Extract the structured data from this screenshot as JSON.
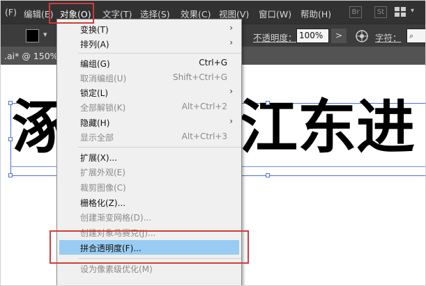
{
  "menubar": {
    "items": [
      {
        "label": "(F)"
      },
      {
        "label": "编辑(E)"
      },
      {
        "label": "对象(O)"
      },
      {
        "label": "文字(T)"
      },
      {
        "label": "选择(S)"
      },
      {
        "label": "效果(C)"
      },
      {
        "label": "视图(V)"
      },
      {
        "label": "窗口(W)"
      },
      {
        "label": "帮助(H)"
      }
    ],
    "bridge_icon": "Br",
    "stock_icon": "St",
    "workspace_icon": "grid-icon"
  },
  "controlbar": {
    "opacity_label": "不透明度：",
    "opacity_value": "100%",
    "opacity_arrow": ">",
    "char_label": "字符："
  },
  "doc": {
    "tab_label": ".ai* @ 150%"
  },
  "canvas": {
    "text_left": "涿",
    "text_right": "江东进"
  },
  "dropdown": {
    "items": [
      {
        "label": "变换(T)",
        "shortcut": "",
        "arrow": "›"
      },
      {
        "label": "排列(A)",
        "shortcut": "",
        "arrow": "›"
      },
      {
        "label": "编组(G)",
        "shortcut": "Ctrl+G",
        "arrow": ""
      },
      {
        "label": "取消编组(U)",
        "shortcut": "Shift+Ctrl+G",
        "arrow": ""
      },
      {
        "label": "锁定(L)",
        "shortcut": "",
        "arrow": "›"
      },
      {
        "label": "全部解锁(K)",
        "shortcut": "Alt+Ctrl+2",
        "arrow": ""
      },
      {
        "label": "隐藏(H)",
        "shortcut": "",
        "arrow": "›"
      },
      {
        "label": "显示全部",
        "shortcut": "Alt+Ctrl+3",
        "arrow": ""
      },
      {
        "label": "扩展(X)...",
        "shortcut": "",
        "arrow": ""
      },
      {
        "label": "扩展外观(E)",
        "shortcut": "",
        "arrow": ""
      },
      {
        "label": "裁剪图像(C)",
        "shortcut": "",
        "arrow": ""
      },
      {
        "label": "栅格化(Z)...",
        "shortcut": "",
        "arrow": ""
      },
      {
        "label": "创建渐变网格(D)...",
        "shortcut": "",
        "arrow": ""
      },
      {
        "label": "创建对象马赛克(J)...",
        "shortcut": "",
        "arrow": ""
      },
      {
        "label": "拼合透明度(F)...",
        "shortcut": "",
        "arrow": ""
      },
      {
        "label": "设为像素级优化(M)",
        "shortcut": "",
        "arrow": ""
      }
    ]
  },
  "colors": {
    "menubar_bg": "#323232",
    "highlight": "#99ccf3",
    "annotation": "#d33a3a"
  }
}
